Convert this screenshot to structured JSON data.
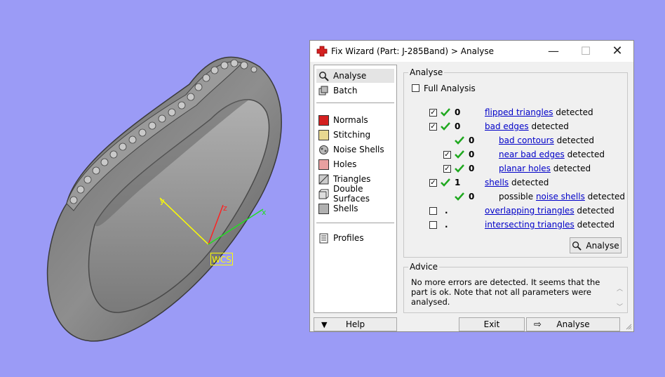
{
  "window": {
    "title": "Fix Wizard (Part: J-285Band) > Analyse",
    "minimize_glyph": "—",
    "maximize_glyph": "☐",
    "close_glyph": "✕"
  },
  "viewport": {
    "wcs_label": "WCS",
    "axis_x": "x",
    "axis_y": "y",
    "axis_z": "z"
  },
  "nav": {
    "top": [
      {
        "label": "Analyse",
        "icon": "magnifier-icon",
        "selected": true
      },
      {
        "label": "Batch",
        "icon": "batch-icon"
      }
    ],
    "tools": [
      {
        "label": "Normals",
        "icon": "normals-icon"
      },
      {
        "label": "Stitching",
        "icon": "stitching-icon"
      },
      {
        "label": "Noise Shells",
        "icon": "noise-shells-icon"
      },
      {
        "label": "Holes",
        "icon": "holes-icon"
      },
      {
        "label": "Triangles",
        "icon": "triangles-icon"
      },
      {
        "label": "Double Surfaces",
        "icon": "double-surfaces-icon"
      },
      {
        "label": "Shells",
        "icon": "shells-icon"
      }
    ],
    "bottom": [
      {
        "label": "Profiles",
        "icon": "profiles-icon"
      }
    ]
  },
  "analyse": {
    "group_title": "Analyse",
    "full_analysis_label": "Full Analysis",
    "full_analysis_checked": false,
    "rows": [
      {
        "checked": true,
        "status": "ok",
        "value": "0",
        "pre": "",
        "link": "flipped triangles",
        "post": " detected"
      },
      {
        "checked": true,
        "status": "ok",
        "value": "0",
        "pre": "",
        "link": "bad edges",
        "post": " detected"
      },
      {
        "checked": null,
        "status": "ok",
        "value": "0",
        "pre": "",
        "link": "bad contours",
        "post": " detected"
      },
      {
        "checked": true,
        "status": "ok",
        "value": "0",
        "pre": "",
        "link": "near bad edges",
        "post": " detected"
      },
      {
        "checked": true,
        "status": "ok",
        "value": "0",
        "pre": "",
        "link": "planar holes",
        "post": " detected"
      },
      {
        "checked": true,
        "status": "ok",
        "value": "1",
        "pre": "",
        "link": "shells",
        "post": " detected"
      },
      {
        "checked": null,
        "status": "ok",
        "value": "0",
        "pre": "possible ",
        "link": "noise shells",
        "post": " detected"
      },
      {
        "checked": false,
        "status": "none",
        "value": ".",
        "pre": "",
        "link": "overlapping triangles",
        "post": " detected"
      },
      {
        "checked": false,
        "status": "none",
        "value": ".",
        "pre": "",
        "link": "intersecting triangles",
        "post": " detected"
      }
    ],
    "analyse_button": "Analyse"
  },
  "advice": {
    "group_title": "Advice",
    "text": "No more errors are detected. It seems that the part is ok. Note that not all parameters were analysed."
  },
  "bottom": {
    "help_label": "Help",
    "exit_label": "Exit",
    "analyse_label": "Analyse"
  },
  "colors": {
    "background": "#9b9bf6",
    "check_green": "#1fa81f",
    "link_blue": "#0000c8"
  }
}
